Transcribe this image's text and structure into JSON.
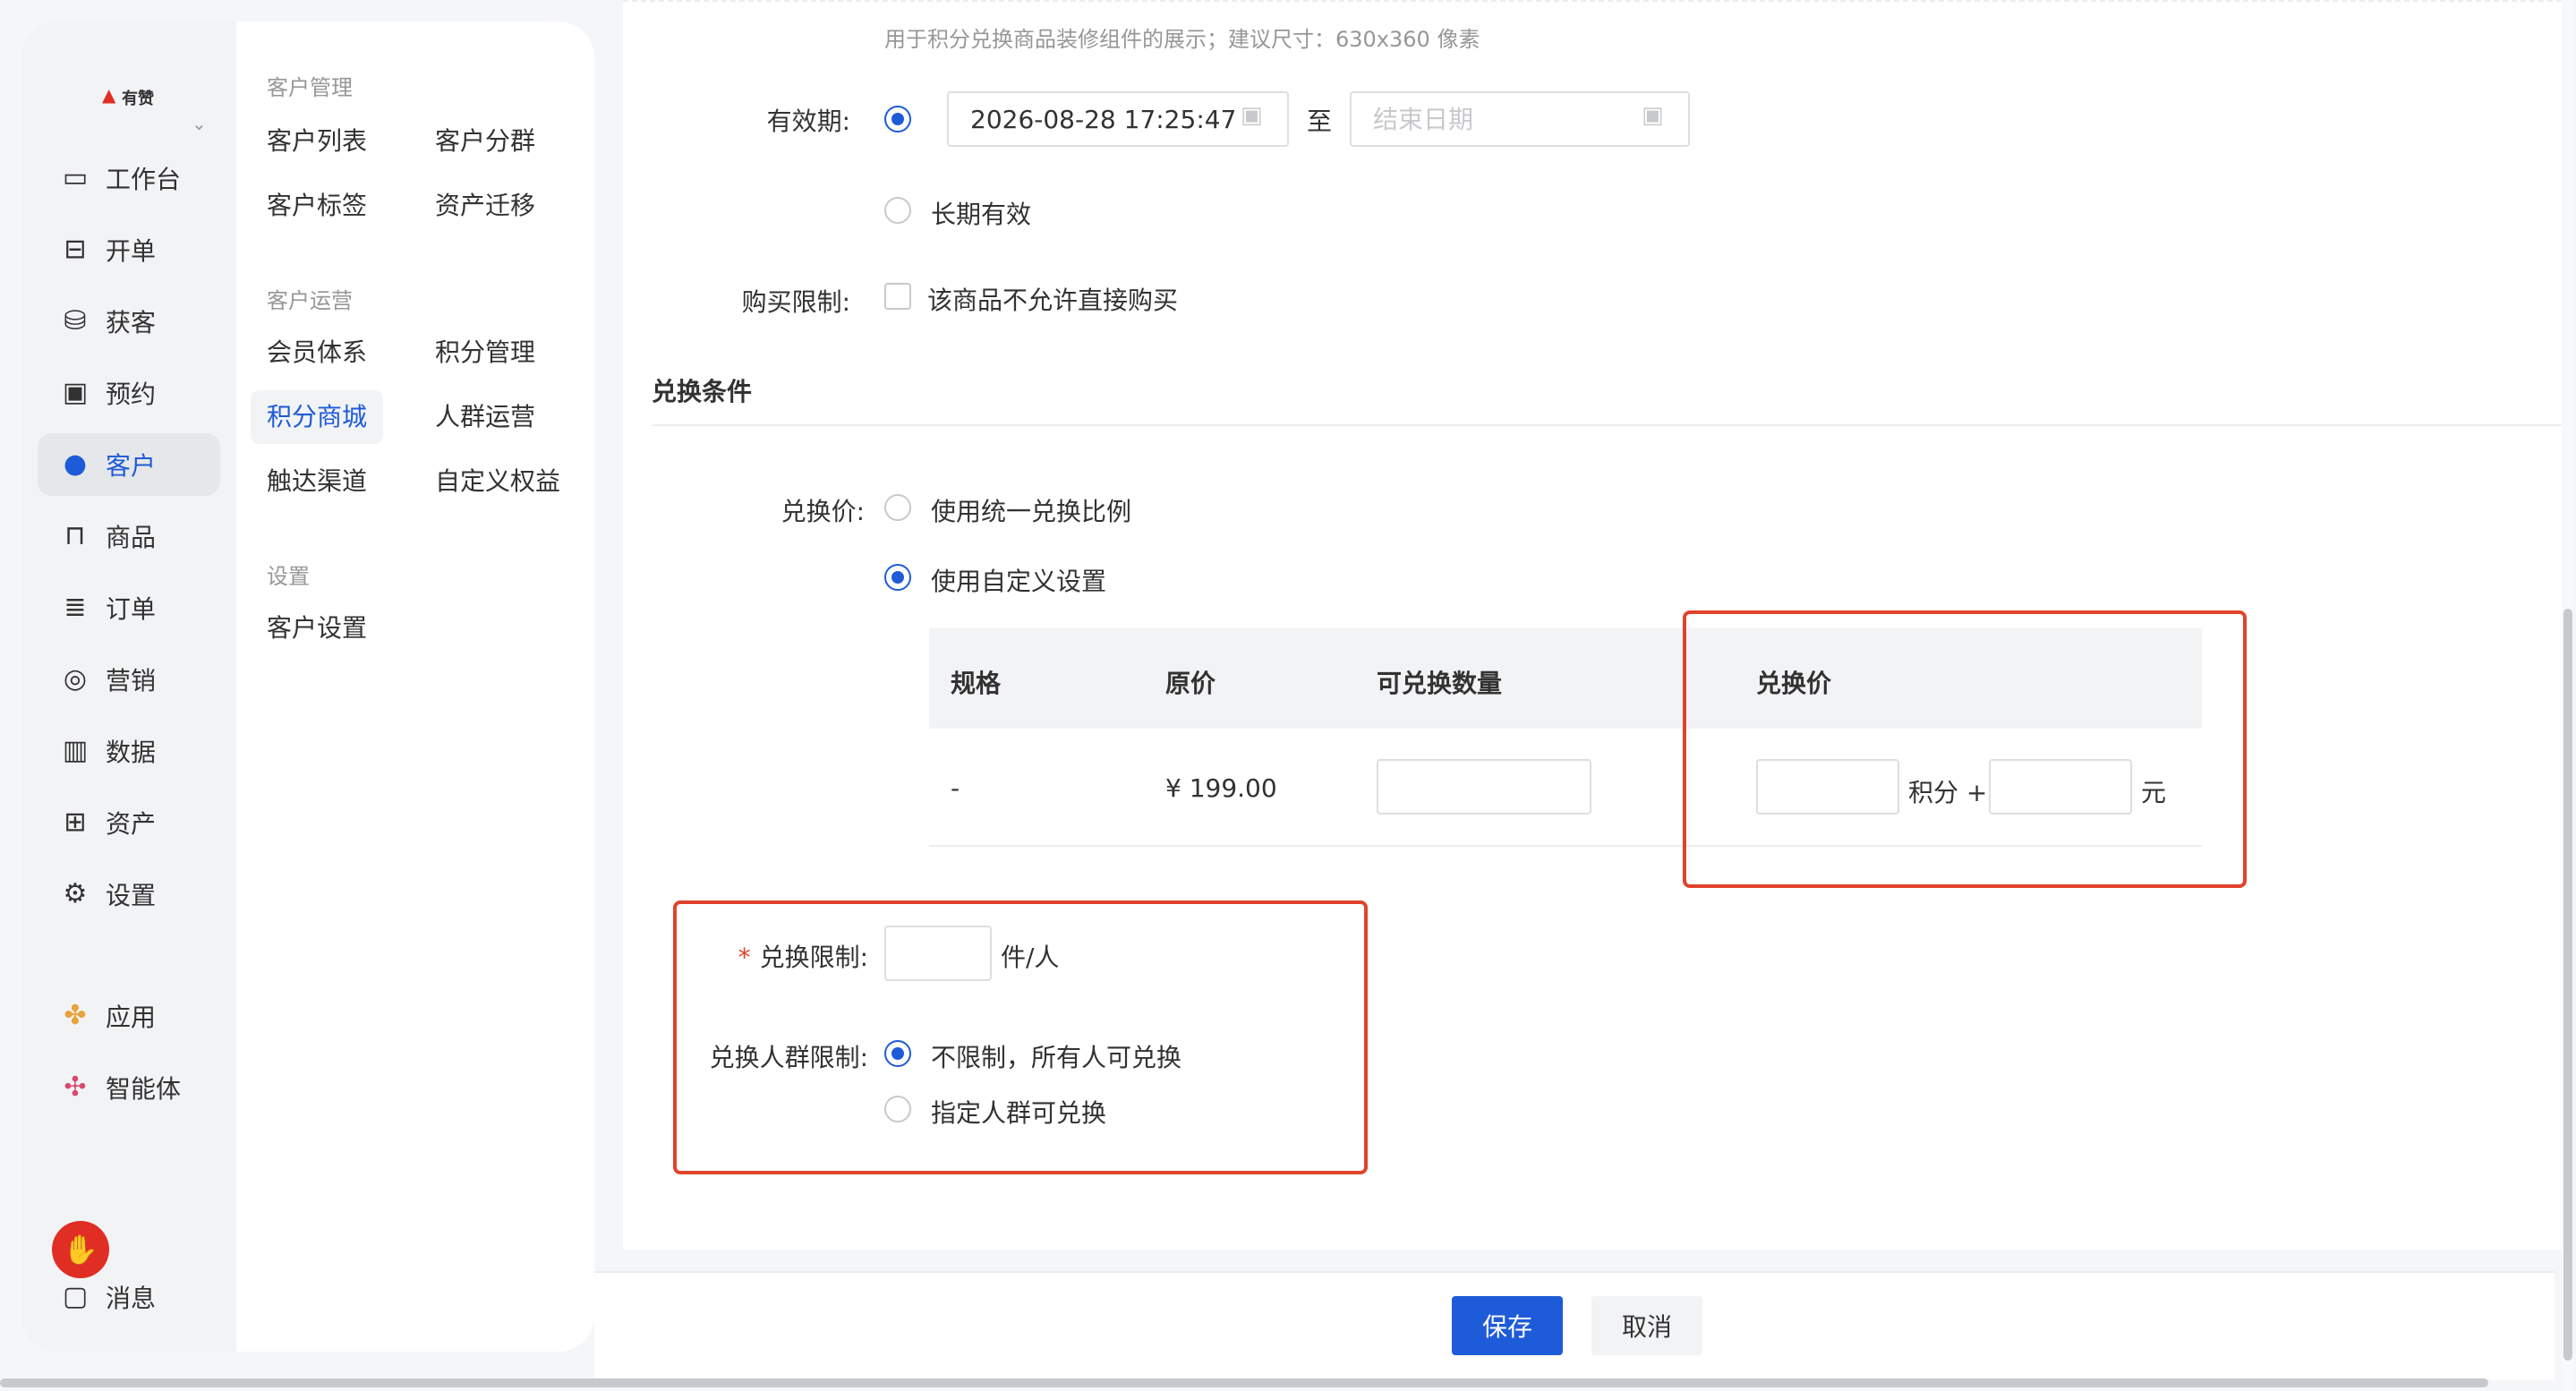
{
  "brand": {
    "logo_text": "有赞"
  },
  "nav_primary": {
    "items": [
      {
        "label": "工作台",
        "icon": "workbench-icon"
      },
      {
        "label": "开单",
        "icon": "order-open-icon"
      },
      {
        "label": "获客",
        "icon": "acquire-icon"
      },
      {
        "label": "预约",
        "icon": "calendar-icon"
      },
      {
        "label": "客户",
        "icon": "customer-icon"
      },
      {
        "label": "商品",
        "icon": "bag-icon"
      },
      {
        "label": "订单",
        "icon": "order-icon"
      },
      {
        "label": "营销",
        "icon": "target-icon"
      },
      {
        "label": "数据",
        "icon": "bar-chart-icon"
      },
      {
        "label": "资产",
        "icon": "asset-icon"
      },
      {
        "label": "设置",
        "icon": "gear-icon"
      },
      {
        "label": "应用",
        "icon": "apps-icon"
      },
      {
        "label": "智能体",
        "icon": "agent-icon"
      },
      {
        "label": "消息",
        "icon": "message-icon"
      }
    ],
    "active": "客户"
  },
  "nav_secondary": {
    "groups": [
      {
        "title": "客户管理",
        "items": [
          "客户列表",
          "客户分群",
          "客户标签",
          "资产迁移"
        ]
      },
      {
        "title": "客户运营",
        "items": [
          "会员体系",
          "积分管理",
          "积分商城",
          "人群运营",
          "触达渠道",
          "自定义权益"
        ]
      },
      {
        "title": "设置",
        "items": [
          "客户设置"
        ]
      }
    ],
    "active": "积分商城"
  },
  "form": {
    "image_hint": "用于积分兑换商品装修组件的展示；建议尺寸：630x360 像素",
    "validity": {
      "label": "有效期:",
      "start_value": "2026-08-28 17:25:47",
      "to": "至",
      "end_placeholder": "结束日期",
      "long_term": "长期有效"
    },
    "purchase_limit": {
      "label": "购买限制:",
      "option": "该商品不允许直接购买"
    },
    "exchange_section_title": "兑换条件",
    "exchange_price": {
      "label": "兑换价:",
      "option_uniform": "使用统一兑换比例",
      "option_custom": "使用自定义设置"
    },
    "table": {
      "headers": [
        "规格",
        "原价",
        "可兑换数量",
        "兑换价"
      ],
      "row": {
        "spec": "-",
        "price": "¥ 199.00",
        "points_unit": "积分 +",
        "yuan_unit": "元"
      }
    },
    "exchange_limit": {
      "label": "兑换限制:",
      "required_mark": "*",
      "unit": "件/人"
    },
    "crowd_limit": {
      "label": "兑换人群限制:",
      "option_all": "不限制，所有人可兑换",
      "option_specific": "指定人群可兑换"
    }
  },
  "actions": {
    "save": "保存",
    "cancel": "取消"
  },
  "colors": {
    "primary": "#1e5bd8",
    "highlight_box": "#e0432b",
    "brand_red": "#e02e24"
  }
}
